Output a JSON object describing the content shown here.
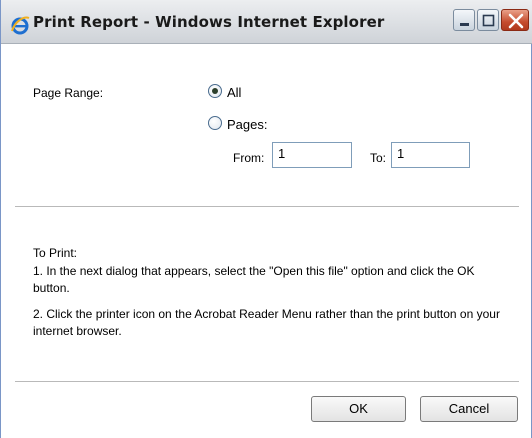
{
  "window": {
    "title": "Print Report - Windows Internet Explorer"
  },
  "page_range": {
    "label": "Page Range:",
    "all_label": "All",
    "pages_label": "Pages:",
    "selected": "All",
    "from_label": "From:",
    "from_value": "1",
    "to_label": "To:",
    "to_value": "1"
  },
  "instructions": {
    "heading": "To Print:",
    "step1": "1. In the next dialog that appears, select the \"Open this file\" option and click the OK button.",
    "step2": "2. Click the printer icon on the Acrobat Reader Menu rather than the print button on your internet browser."
  },
  "buttons": {
    "ok": "OK",
    "cancel": "Cancel"
  }
}
